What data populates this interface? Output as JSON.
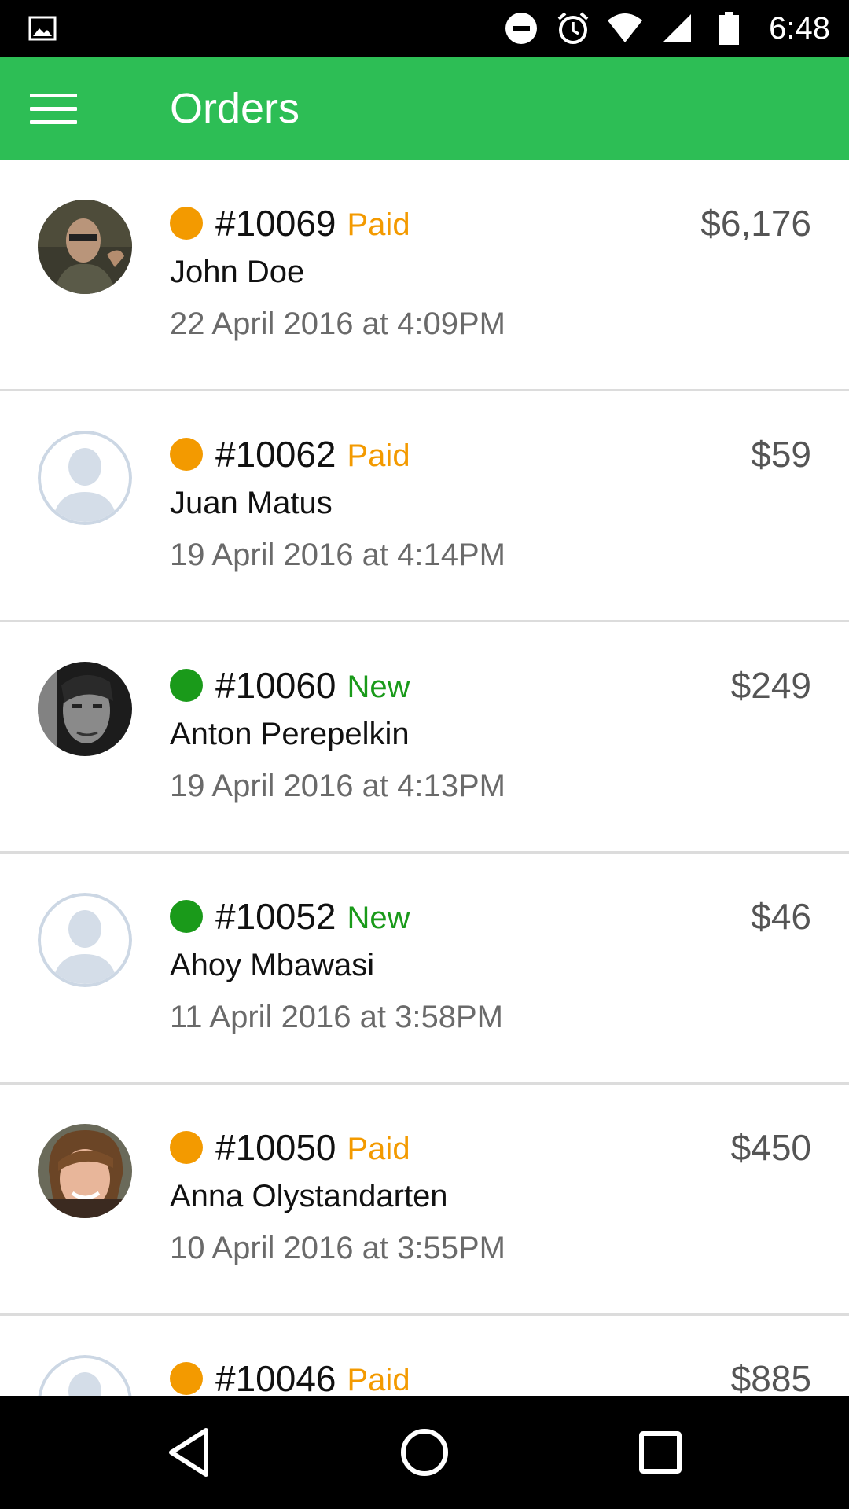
{
  "status_bar": {
    "time": "6:48",
    "icons": [
      "image-icon",
      "do-not-disturb-icon",
      "alarm-icon",
      "wifi-icon",
      "signal-icon",
      "battery-icon"
    ]
  },
  "app_bar": {
    "title": "Orders",
    "menu_icon": "hamburger-menu-icon",
    "color": "#2dbe55"
  },
  "status_colors": {
    "Paid": "#f39a00",
    "New": "#1a9a1a"
  },
  "orders": [
    {
      "number": "#10069",
      "status": "Paid",
      "customer": "John Doe",
      "date": "22 April 2016 at 4:09PM",
      "amount": "$6,176",
      "avatar": "photo"
    },
    {
      "number": "#10062",
      "status": "Paid",
      "customer": "Juan Matus",
      "date": "19 April 2016 at 4:14PM",
      "amount": "$59",
      "avatar": "placeholder"
    },
    {
      "number": "#10060",
      "status": "New",
      "customer": "Anton Perepelkin",
      "date": "19 April 2016 at 4:13PM",
      "amount": "$249",
      "avatar": "photo"
    },
    {
      "number": "#10052",
      "status": "New",
      "customer": "Ahoy Mbawasi",
      "date": "11 April 2016 at 3:58PM",
      "amount": "$46",
      "avatar": "placeholder"
    },
    {
      "number": "#10050",
      "status": "Paid",
      "customer": "Anna Olystandarten",
      "date": "10 April 2016 at 3:55PM",
      "amount": "$450",
      "avatar": "photo"
    },
    {
      "number": "#10046",
      "status": "Paid",
      "customer": "",
      "date": "",
      "amount": "$885",
      "avatar": "placeholder"
    }
  ],
  "nav_bar": {
    "icons": [
      "back-icon",
      "home-icon",
      "recents-icon"
    ]
  }
}
